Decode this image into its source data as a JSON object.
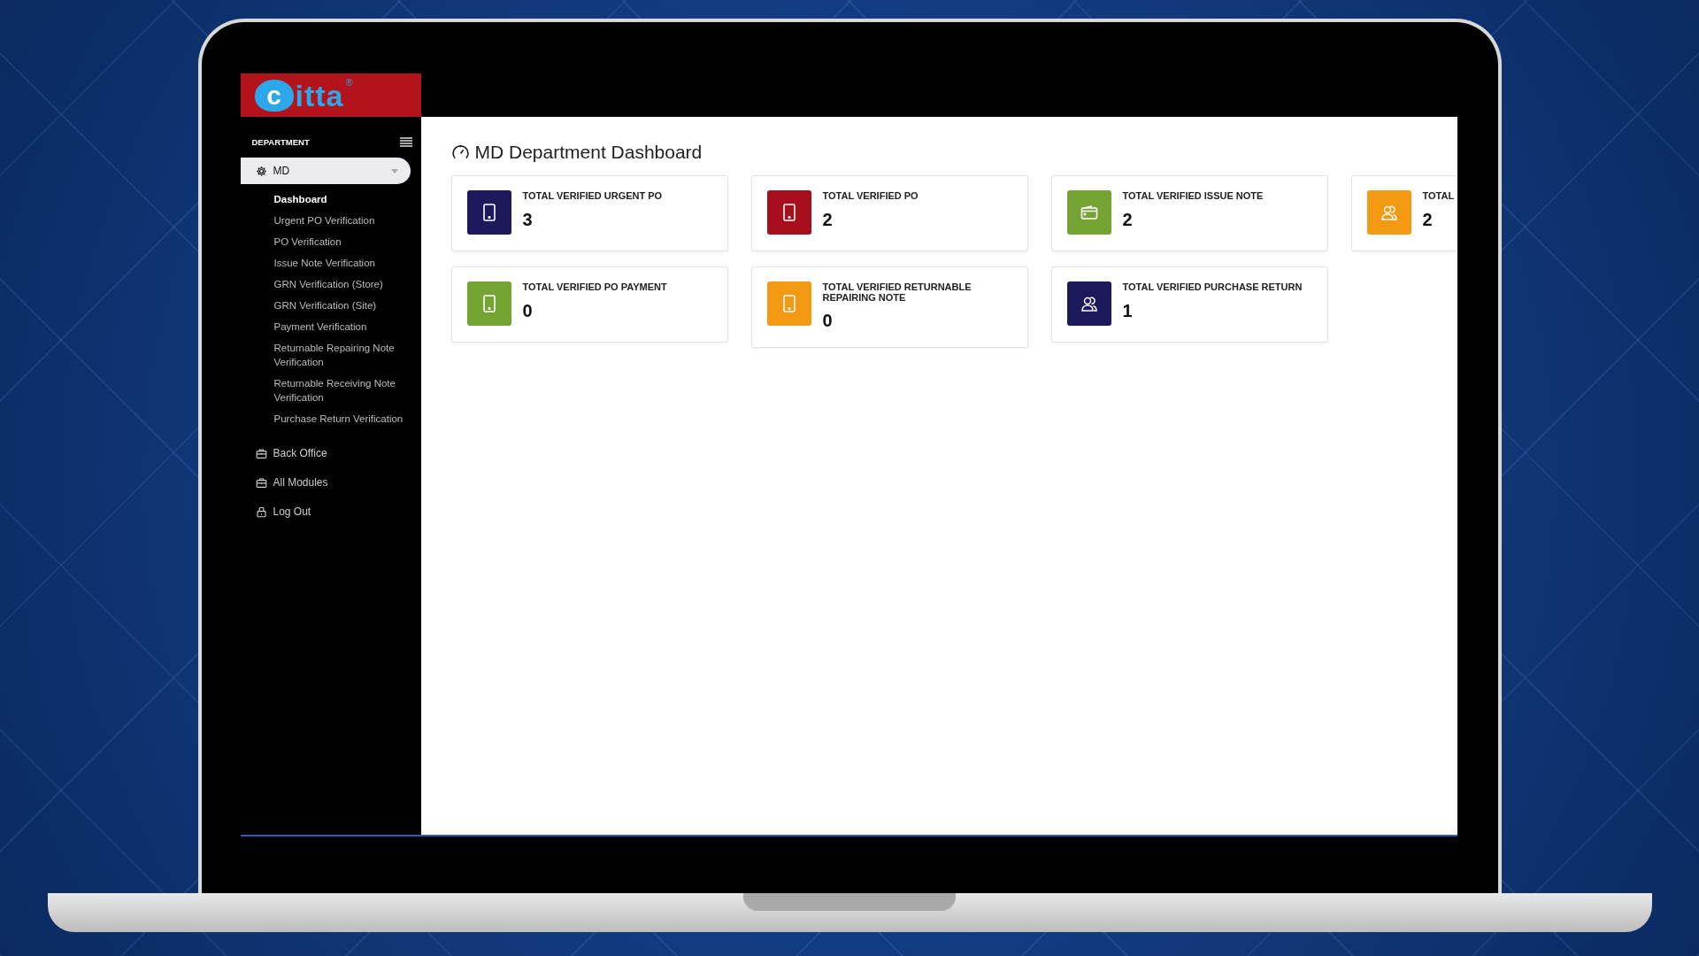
{
  "logo": {
    "mark": "c",
    "text": "itta",
    "registered": "®"
  },
  "sidebar": {
    "section_label": "DEPARTMENT",
    "items": [
      {
        "label": "MD",
        "kind": "gear",
        "selected": true,
        "expanded": true,
        "children": [
          {
            "label": "Dashboard",
            "selected": true
          },
          {
            "label": "Urgent PO Verification",
            "selected": false
          },
          {
            "label": "PO Verification",
            "selected": false
          },
          {
            "label": "Issue Note Verification",
            "selected": false
          },
          {
            "label": "GRN Verification (Store)",
            "selected": false
          },
          {
            "label": "GRN Verification (Site)",
            "selected": false
          },
          {
            "label": "Payment Verification",
            "selected": false
          },
          {
            "label": "Returnable Repairing Note Verification",
            "selected": false
          },
          {
            "label": "Returnable Receiving Note Verification",
            "selected": false
          },
          {
            "label": "Purchase Return Verification",
            "selected": false
          }
        ]
      },
      {
        "label": "Back Office",
        "kind": "briefcase",
        "selected": false
      },
      {
        "label": "All Modules",
        "kind": "briefcase",
        "selected": false
      },
      {
        "label": "Log Out",
        "kind": "lock",
        "selected": false
      }
    ]
  },
  "page_title": "MD Department Dashboard",
  "cards": [
    {
      "title": "TOTAL VERIFIED URGENT PO",
      "value": "3",
      "kind": "tablet",
      "color": "#1c1a5a"
    },
    {
      "title": "TOTAL VERIFIED PO",
      "value": "2",
      "kind": "tablet",
      "color": "#a80f1c"
    },
    {
      "title": "TOTAL VERIFIED ISSUE NOTE",
      "value": "2",
      "kind": "wallet",
      "color": "#75a334"
    },
    {
      "title": "TOTAL",
      "value": "2",
      "kind": "users",
      "color": "#f39a12"
    },
    {
      "title": "TOTAL VERIFIED PO PAYMENT",
      "value": "0",
      "kind": "tablet",
      "color": "#75a334"
    },
    {
      "title": "TOTAL VERIFIED RETURNABLE REPAIRING NOTE",
      "value": "0",
      "kind": "tablet",
      "color": "#f39a12"
    },
    {
      "title": "TOTAL VERIFIED PURCHASE RETURN",
      "value": "1",
      "kind": "users",
      "color": "#1c1a5a"
    }
  ]
}
